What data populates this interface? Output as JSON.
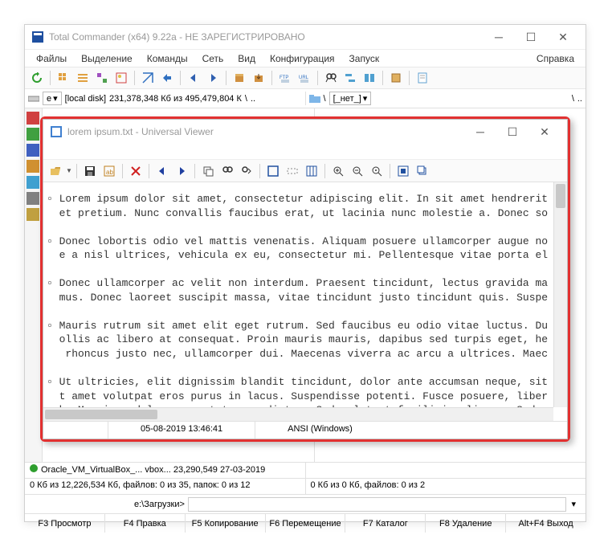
{
  "tc": {
    "title": "Total Commander (x64) 9.22a - НЕ ЗАРЕГИСТРИРОВАНО",
    "menu": [
      "Файлы",
      "Выделение",
      "Команды",
      "Сеть",
      "Вид",
      "Конфигурация",
      "Запуск"
    ],
    "help": "Справка",
    "drive_left": {
      "letter": "e",
      "label": "[local disk]",
      "space": "231,378,348 Кб из 495,479,804 К"
    },
    "drive_right": {
      "none": "[_нет_]"
    },
    "path_left": "\\ ..",
    "status_left_top": "Oracle_VM_VirtualBox_... vbox... 23,290,549 27-03-2019",
    "status_left": "0 Кб из 12,226,534 Кб, файлов: 0 из 35, папок: 0 из 12",
    "status_right": "0 Кб из 0 Кб, файлов: 0 из 2",
    "cmd_label": "e:\\Загрузки>",
    "fkeys": [
      "F3 Просмотр",
      "F4 Правка",
      "F5 Копирование",
      "F6 Перемещение",
      "F7 Каталог",
      "F8 Удаление",
      "Alt+F4 Выход"
    ]
  },
  "uv": {
    "title": "lorem ipsum.txt - Universal Viewer",
    "paragraphs": [
      [
        "Lorem ipsum dolor sit amet, consectetur adipiscing elit. In sit amet hendrerit",
        "et pretium. Nunc convallis faucibus erat, ut lacinia nunc molestie a. Donec so"
      ],
      [
        "Donec lobortis odio vel mattis venenatis. Aliquam posuere ullamcorper augue no",
        "e a nisl ultrices, vehicula ex eu, consectetur mi. Pellentesque vitae porta el"
      ],
      [
        "Donec ullamcorper ac velit non interdum. Praesent tincidunt, lectus gravida ma",
        "mus. Donec laoreet suscipit massa, vitae tincidunt justo tincidunt quis. Suspe"
      ],
      [
        "Mauris rutrum sit amet elit eget rutrum. Sed faucibus eu odio vitae luctus. Du",
        "ollis ac libero at consequat. Proin mauris mauris, dapibus sed turpis eget, he",
        " rhoncus justo nec, ullamcorper dui. Maecenas viverra ac arcu a ultrices. Maec"
      ],
      [
        "Ut ultricies, elit dignissim blandit tincidunt, dolor ante accumsan neque, sit",
        "t amet volutpat eros purus in lacus. Suspendisse potenti. Fusce posuere, liber",
        "h. Mauris sodales arcu ut tempus dictum. Sed volutpat facilisis aliquam. Sed m"
      ]
    ],
    "status_time": "05-08-2019 13:46:41",
    "status_enc": "ANSI (Windows)"
  },
  "icons": {
    "refresh": "#2e9e2e",
    "grid": "#d08030",
    "star": "#c09020",
    "globe": "#3070c0",
    "arrow": "#3060b0",
    "floppy": "#1e4fa0"
  }
}
